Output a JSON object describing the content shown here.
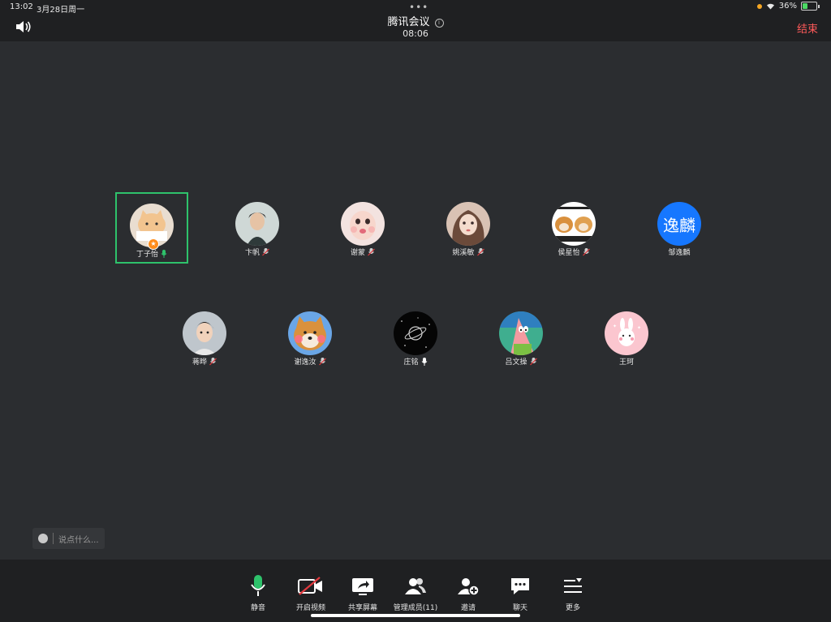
{
  "status_bar": {
    "time": "13:02",
    "date": "3月28日周一",
    "battery": "36%"
  },
  "header": {
    "title": "腾讯会议",
    "timer": "08:06",
    "end_label": "结束"
  },
  "participants_row1": [
    {
      "name": "丁子怡",
      "mic": "on-active",
      "avatar": "cat-sticker",
      "host": true,
      "speaking": true
    },
    {
      "name": "卞帆",
      "mic": "muted",
      "avatar": "person-photo"
    },
    {
      "name": "谢蒙",
      "mic": "muted",
      "avatar": "child-photo"
    },
    {
      "name": "姚溪敏",
      "mic": "muted",
      "avatar": "girl-photo"
    },
    {
      "name": "侯星怡",
      "mic": "muted",
      "avatar": "dog-meme"
    },
    {
      "name": "邹逸麟",
      "mic": "none",
      "avatar": "text-avatar",
      "avatar_text": "逸麟",
      "avatar_color": "#1677ff"
    }
  ],
  "participants_row2": [
    {
      "name": "蒋晔",
      "mic": "muted",
      "avatar": "boy-photo"
    },
    {
      "name": "谢逸汝",
      "mic": "muted",
      "avatar": "shiba-photo"
    },
    {
      "name": "庄铭",
      "mic": "on",
      "avatar": "planet-icon"
    },
    {
      "name": "吕文操",
      "mic": "muted",
      "avatar": "patrick-cartoon"
    },
    {
      "name": "王珂",
      "mic": "none",
      "avatar": "bunny-cartoon"
    }
  ],
  "chat": {
    "placeholder": "说点什么..."
  },
  "toolbar": {
    "mute_label": "静音",
    "video_label": "开启视频",
    "share_label": "共享屏幕",
    "members_label": "管理成员(11)",
    "invite_label": "邀请",
    "chat_label": "聊天",
    "more_label": "更多"
  },
  "colors": {
    "accent_green": "#2ec26b",
    "end_red": "#ff5a5a",
    "video_off_red": "#e0393e"
  }
}
